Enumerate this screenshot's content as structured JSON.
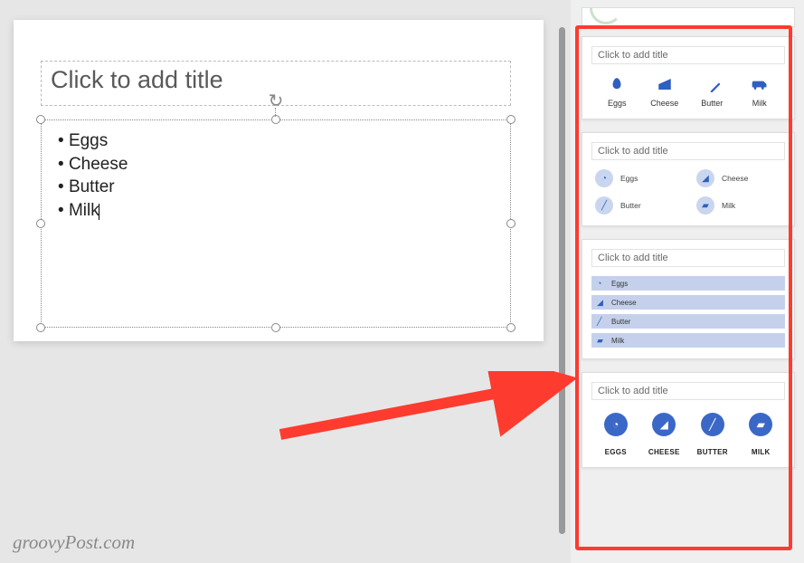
{
  "slide": {
    "title_placeholder": "Click to add title",
    "bullets": [
      "Eggs",
      "Cheese",
      "Butter",
      "Milk"
    ]
  },
  "watermark": "groovyPost.com",
  "design_ideas": {
    "idea_title_placeholder": "Click to add title",
    "items": [
      {
        "label": "Eggs",
        "upper": "EGGS"
      },
      {
        "label": "Cheese",
        "upper": "CHEESE"
      },
      {
        "label": "Butter",
        "upper": "BUTTER"
      },
      {
        "label": "Milk",
        "upper": "MILK"
      }
    ]
  }
}
